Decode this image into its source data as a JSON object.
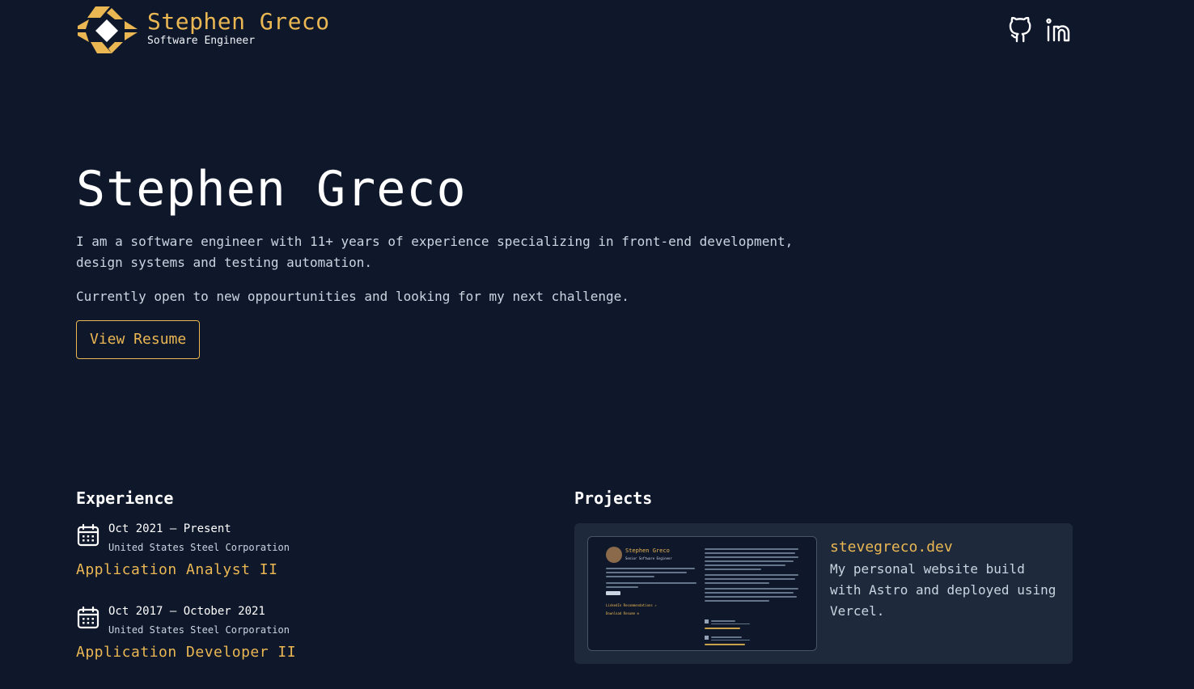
{
  "header": {
    "brand_name": "Stephen Greco",
    "brand_role": "Software Engineer",
    "social": [
      {
        "name": "github-icon",
        "label": "GitHub"
      },
      {
        "name": "linkedin-icon",
        "label": "LinkedIn"
      }
    ]
  },
  "hero": {
    "title": "Stephen Greco",
    "intro": "I am a software engineer with 11+ years of experience specializing in front-end development, design systems and testing automation.",
    "status": "Currently open to new oppourtunities and looking for my next challenge.",
    "resume_label": "View Resume"
  },
  "experience": {
    "title": "Experience",
    "items": [
      {
        "dates": "Oct 2021 – Present",
        "company": "United States Steel Corporation",
        "role": "Application Analyst II"
      },
      {
        "dates": "Oct 2017 – October 2021",
        "company": "United States Steel Corporation",
        "role": "Application Developer II"
      }
    ]
  },
  "projects": {
    "title": "Projects",
    "items": [
      {
        "name": "stevegreco.dev",
        "description": "My personal website build with Astro and deployed using Vercel."
      }
    ]
  },
  "thumbnail": {
    "name": "Stephen Greco",
    "role": "Senior Software Engineer",
    "link1": "LinkedIn Recommendations ↗",
    "link2": "Download Resume ⊕"
  },
  "colors": {
    "background": "#0f172a",
    "card": "#1e293b",
    "accent": "#eab753",
    "text": "#f1f5f9",
    "muted": "#cbd5e1"
  }
}
